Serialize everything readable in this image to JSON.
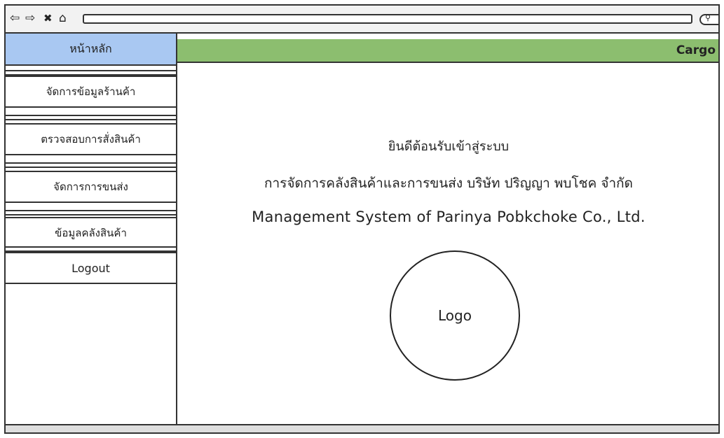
{
  "browser": {
    "back_icon": "⇦",
    "forward_icon": "⇨",
    "close_icon": "✖",
    "home_icon": "⌂",
    "search_icon": "⚲"
  },
  "sidebar": {
    "home_label": "หน้าหลัก",
    "items": [
      {
        "label": "จัดการข้อมูลร้านค้า"
      },
      {
        "label": "ตรวจสอบการสั่งสินค้า"
      },
      {
        "label": "จัดการการขนส่ง"
      },
      {
        "label": "ข้อมูลคลังสินค้า"
      },
      {
        "label": "Logout"
      }
    ]
  },
  "header": {
    "brand": "Cargo",
    "color": "#8cbe6f"
  },
  "main": {
    "welcome_line1": "ยินดีต้อนรับเข้าสู่ระบบ",
    "welcome_line2": "การจัดการคลังสินค้าและการขนส่ง บริษัท ปริญญา พบโชค จำกัด",
    "welcome_line3": "Management System of Parinya Pobkchoke Co., Ltd.",
    "logo_label": "Logo"
  }
}
